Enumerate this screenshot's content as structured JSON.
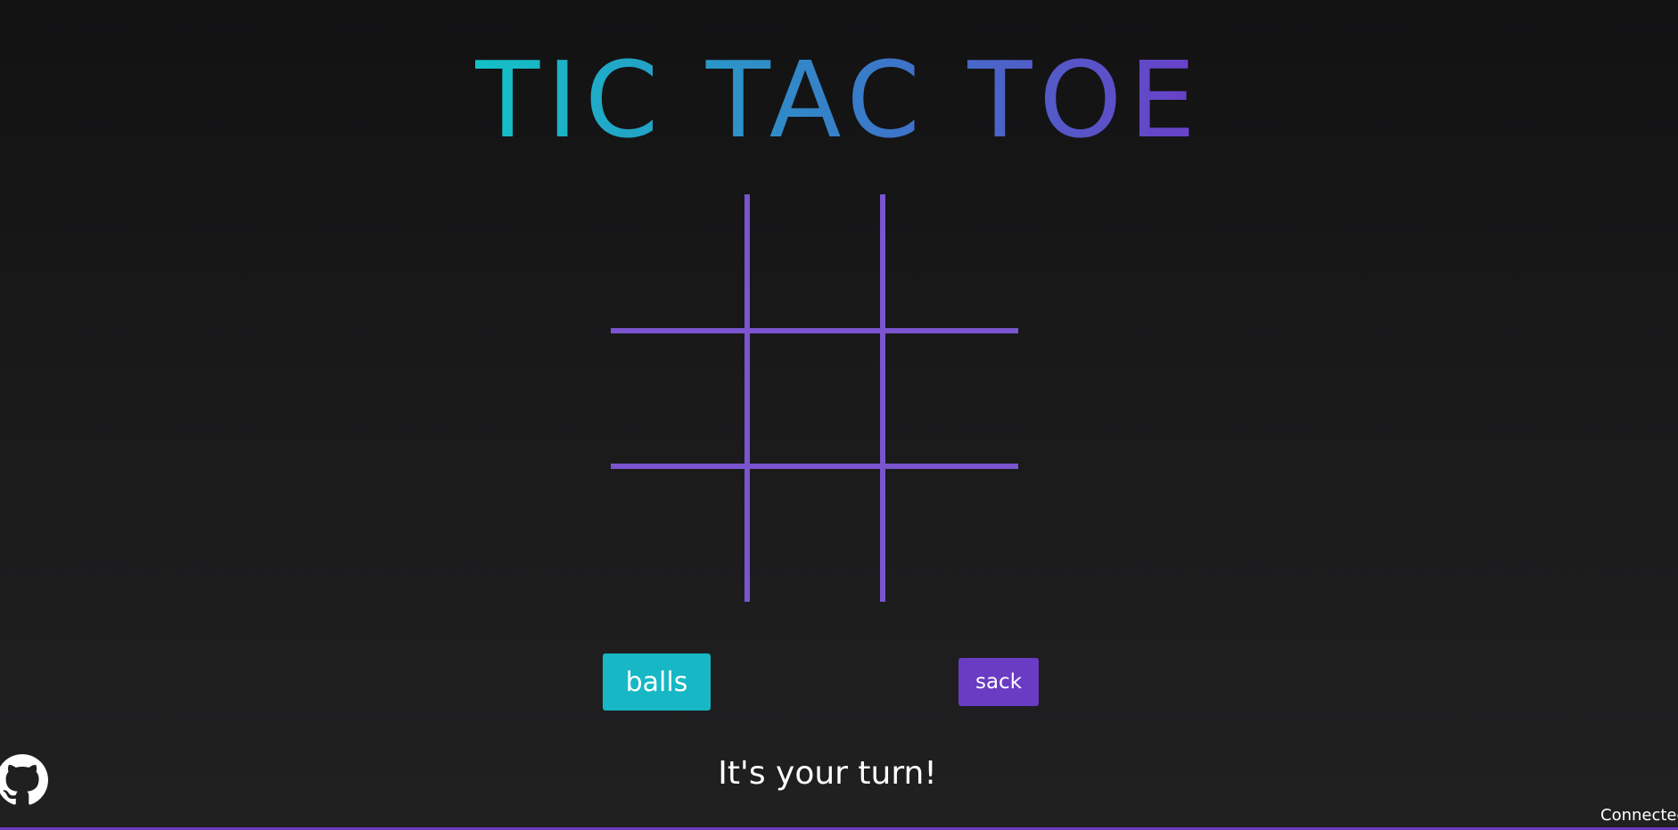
{
  "game": {
    "title": "TIC TAC TOE",
    "status": "It's your turn!",
    "board": {
      "cells": [
        "",
        "",
        "",
        "",
        "",
        "",
        "",
        "",
        ""
      ]
    }
  },
  "players": {
    "player1": {
      "label": "balls",
      "color": "#17b7c6"
    },
    "player2": {
      "label": "sack",
      "color": "#6a3cc3"
    }
  },
  "footer": {
    "connection_status": "Connected",
    "github_icon": "github-icon"
  },
  "colors": {
    "background": "#141415",
    "grid": "#7a55cf",
    "title_gradient_start": "#13c1c6",
    "title_gradient_end": "#6a3fc8"
  }
}
